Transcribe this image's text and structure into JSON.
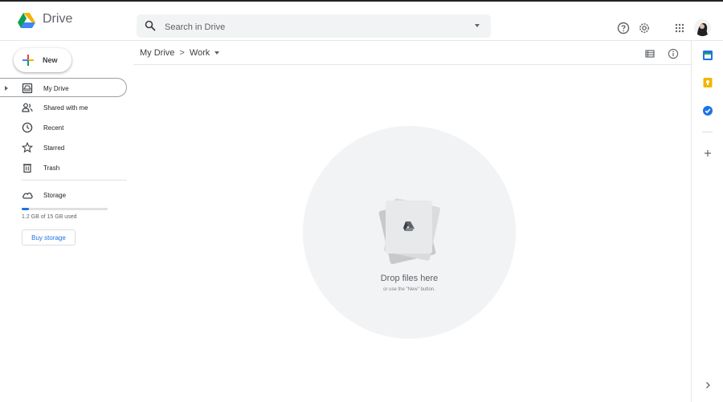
{
  "header": {
    "app_name": "Drive",
    "search_placeholder": "Search in Drive",
    "icons": [
      "drive-logo",
      "search-icon",
      "search-options-caret",
      "help-icon",
      "settings-icon",
      "apps-grid-icon",
      "account-avatar"
    ]
  },
  "sidebar": {
    "new_label": "New",
    "items": [
      {
        "label": "My Drive",
        "icon": "my-drive-icon",
        "active": true
      },
      {
        "label": "Shared with me",
        "icon": "shared-icon"
      },
      {
        "label": "Recent",
        "icon": "clock-icon"
      },
      {
        "label": "Starred",
        "icon": "star-icon"
      },
      {
        "label": "Trash",
        "icon": "trash-icon"
      }
    ],
    "storage": {
      "label": "Storage",
      "usage_text": "1.2 GB of 15 GB used",
      "used_fraction": 0.08,
      "buy_label": "Buy storage"
    }
  },
  "main": {
    "breadcrumbs": [
      "My Drive",
      "Work"
    ],
    "breadcrumb_separator": ">",
    "drop_title": "Drop files here",
    "drop_subtitle": "or use the \"New\" button."
  },
  "right_panel": {
    "icons": [
      "calendar-icon",
      "keep-icon",
      "tasks-icon",
      "add-icon",
      "expand-icon"
    ]
  },
  "colors": {
    "accent_blue": "#1a73e8",
    "drive_green": "#0f9d58",
    "drive_yellow": "#f4b400",
    "drive_blue": "#4285f4",
    "drive_red": "#ea4335",
    "drop_circle": "#f1f3f4"
  }
}
